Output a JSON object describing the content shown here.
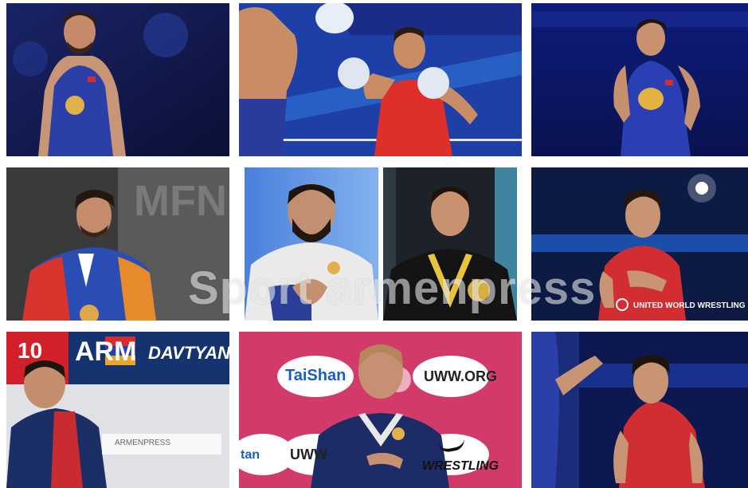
{
  "collage": {
    "watermark": "Sport armenpress",
    "tiles": [
      {
        "id": "wrestler-blue-arena"
      },
      {
        "id": "boxer-red-punch"
      },
      {
        "id": "wrestler-blue-hands-on-hips"
      },
      {
        "id": "wrestler-medal-armenia-jacket"
      },
      {
        "id": "athlete-white-jacket-clapping"
      },
      {
        "id": "boxer-gold-medal"
      },
      {
        "id": "wrestler-red-hand-on-chest",
        "caption": "UNITED WORLD WRESTLING"
      },
      {
        "id": "wrestler-arm-board",
        "number": "10",
        "country": "ARM",
        "name": "DAVTYAN Artur",
        "logo": "ARMENPRESS"
      },
      {
        "id": "wrestler-podium-hand-on-heart",
        "sponsors": [
          "TaiShan",
          "UWW.ORG",
          "UWW",
          "WRESTLING",
          "tan"
        ]
      },
      {
        "id": "wrestler-red-crouching"
      }
    ]
  },
  "colors": {
    "blue": "#2a3fa8",
    "red": "#d62d2d",
    "pink": "#d23a6a",
    "navy": "#0d1640"
  }
}
